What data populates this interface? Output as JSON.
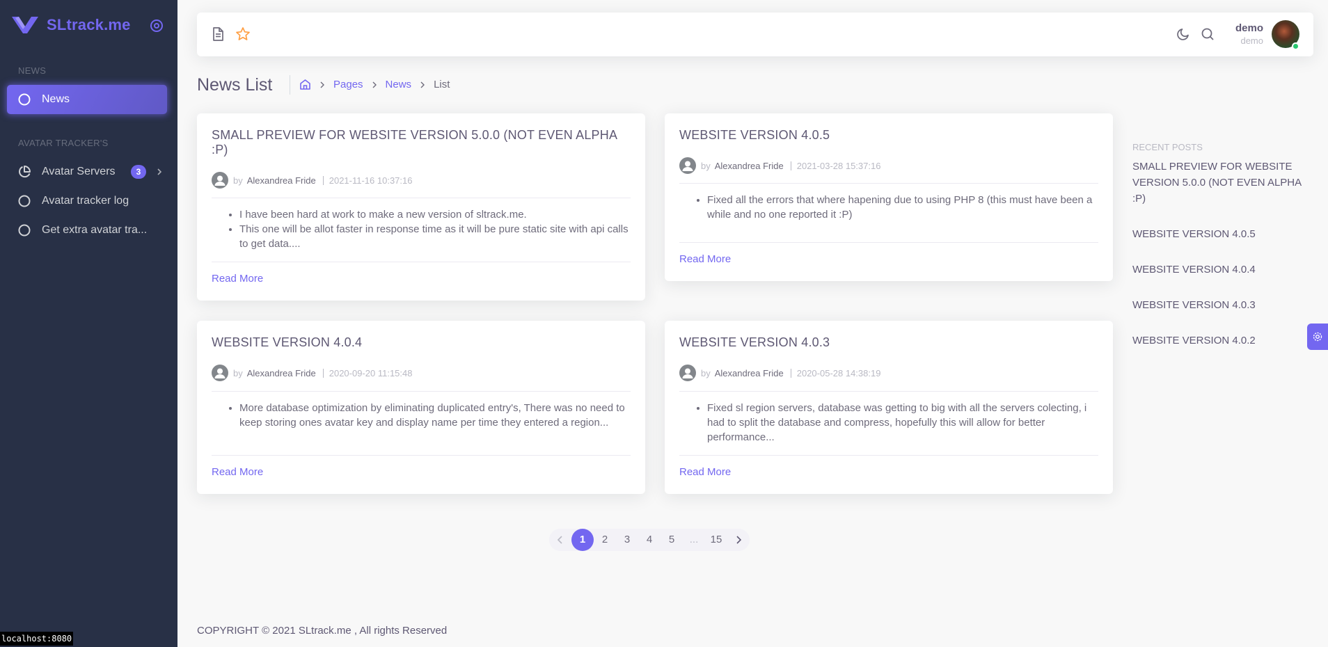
{
  "brand": {
    "name": "SLtrack.me"
  },
  "sidebar": {
    "section_news": "NEWS",
    "news_item": "News",
    "section_tracker": "AVATAR TRACKER'S",
    "items": [
      {
        "label": "Avatar Servers",
        "badge": "3"
      },
      {
        "label": "Avatar tracker log"
      },
      {
        "label": "Get extra avatar tra..."
      }
    ]
  },
  "navbar": {
    "user_name": "demo",
    "user_role": "demo"
  },
  "header": {
    "title": "News List",
    "breadcrumb": [
      "Pages",
      "News",
      "List"
    ]
  },
  "posts": [
    {
      "title": "SMALL PREVIEW FOR WEBSITE VERSION 5.0.0 (NOT EVEN ALPHA :P)",
      "by": "by",
      "author": "Alexandrea Fride",
      "date": "2021-11-16 10:37:16",
      "bullets": [
        "I have been hard at work to make a new version of sltrack.me.",
        "This one will be allot faster in response time as it will be pure static site with api calls to get data...."
      ],
      "read_more": "Read More"
    },
    {
      "title": "WEBSITE VERSION 4.0.5",
      "by": "by",
      "author": "Alexandrea Fride",
      "date": "2021-03-28 15:37:16",
      "bullets": [
        "Fixed all the errors that where hapening due to using PHP 8 (this must have been a while and no one reported it :P)"
      ],
      "read_more": "Read More"
    },
    {
      "title": "WEBSITE VERSION 4.0.4",
      "by": "by",
      "author": "Alexandrea Fride",
      "date": "2020-09-20 11:15:48",
      "bullets": [
        "More database optimization by eliminating duplicated entry's, There was no need to keep storing ones avatar key and display name per time they entered a region..."
      ],
      "read_more": "Read More"
    },
    {
      "title": "WEBSITE VERSION 4.0.3",
      "by": "by",
      "author": "Alexandrea Fride",
      "date": "2020-05-28 14:38:19",
      "bullets": [
        "Fixed sl region servers, database was getting to big with all the servers colecting, i had to split the database and compress, hopefully this will allow for better performance..."
      ],
      "read_more": "Read More"
    }
  ],
  "recent_posts": {
    "header": "RECENT POSTS",
    "items": [
      "SMALL PREVIEW FOR WEBSITE VERSION 5.0.0 (NOT EVEN ALPHA :P)",
      "WEBSITE VERSION 4.0.5",
      "WEBSITE VERSION 4.0.4",
      "WEBSITE VERSION 4.0.3",
      "WEBSITE VERSION 4.0.2"
    ]
  },
  "pagination": {
    "pages": [
      "1",
      "2",
      "3",
      "4",
      "5",
      "...",
      "15"
    ],
    "current": "1"
  },
  "footer": {
    "copyright": "COPYRIGHT © 2021 SLtrack.me , All rights Reserved"
  },
  "statusbar": {
    "url": "localhost:8080"
  },
  "colors": {
    "primary": "#7367f0",
    "sidebar": "#283046",
    "online": "#28c76f"
  }
}
